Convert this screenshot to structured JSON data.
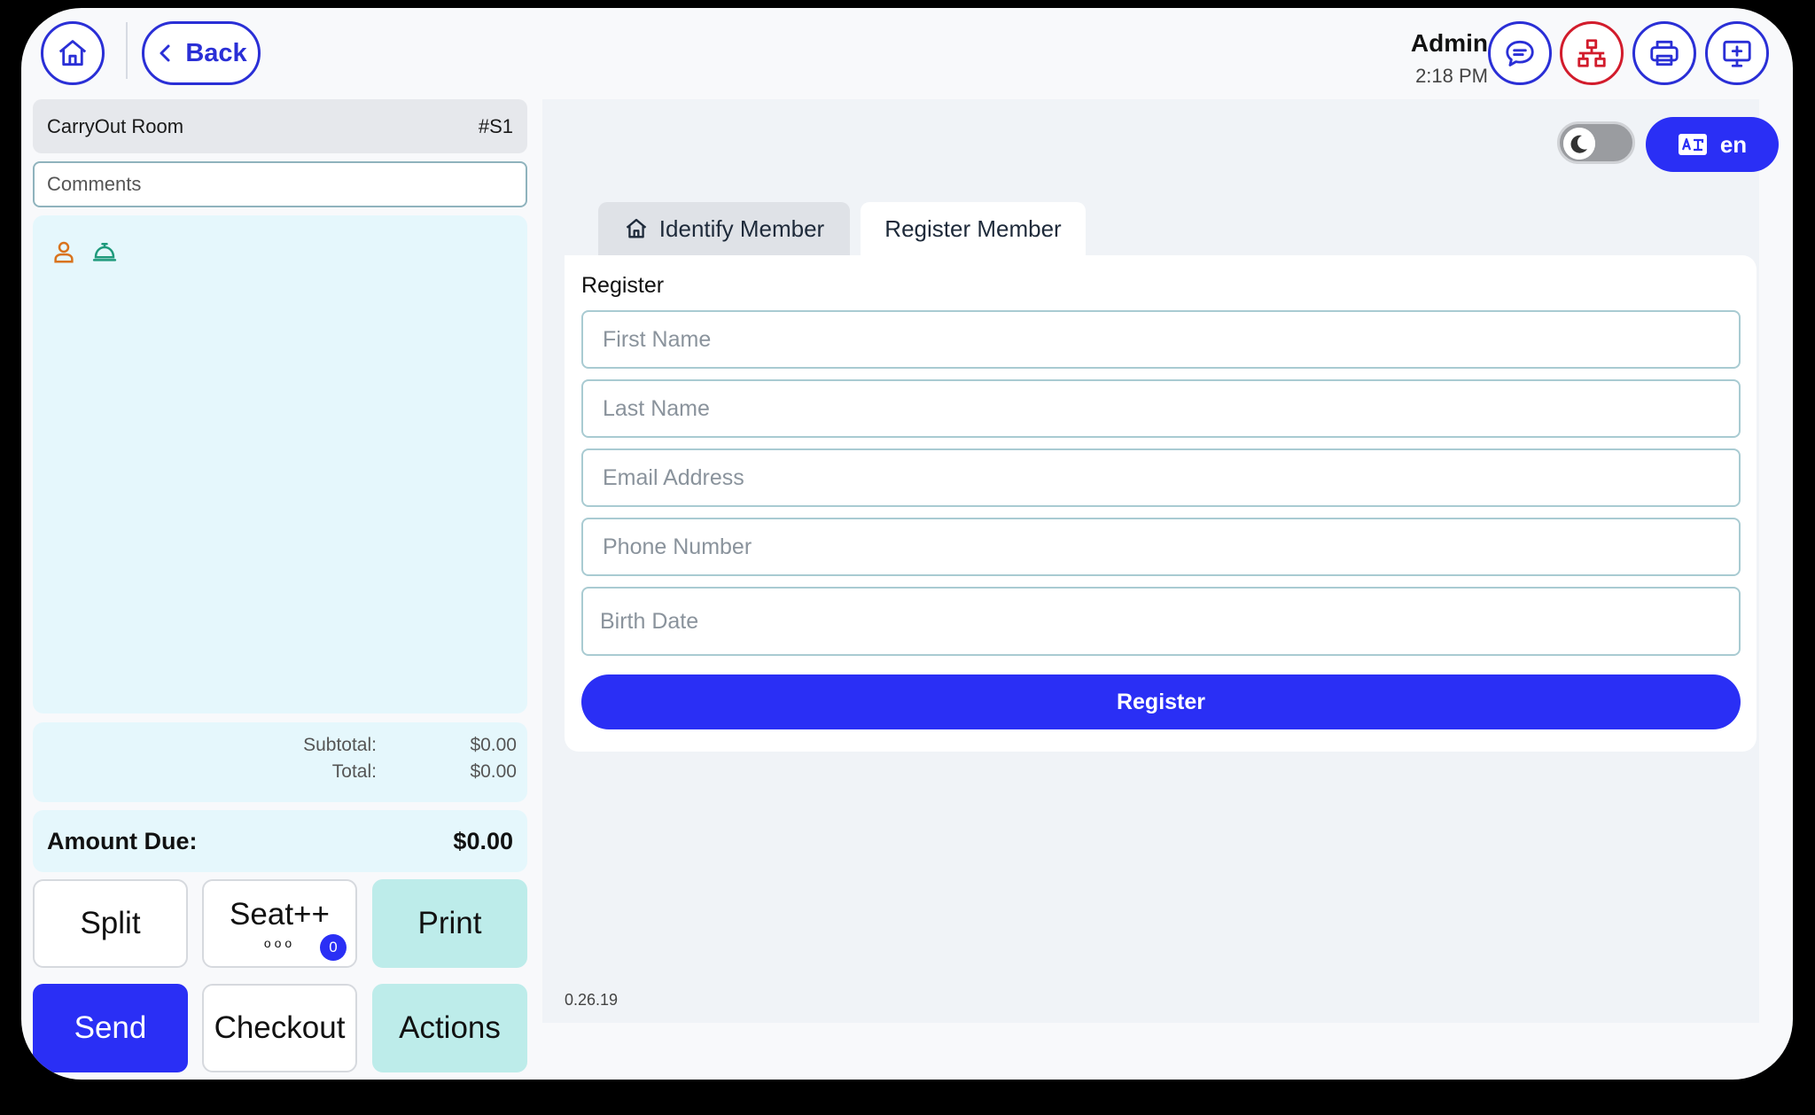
{
  "header": {
    "back_label": "Back",
    "user_name": "Admin",
    "time": "2:18 PM",
    "icons": [
      "home-icon",
      "chat-icon",
      "network-icon",
      "printer-icon",
      "add-screen-icon"
    ],
    "accent_color": "#2a2ff5",
    "alert_color": "#d21c2c"
  },
  "order": {
    "room_name": "CarryOut Room",
    "seat_code": "#S1",
    "comments_placeholder": "Comments",
    "subtotal_label": "Subtotal:",
    "subtotal_value": "$0.00",
    "total_label": "Total:",
    "total_value": "$0.00",
    "amount_due_label": "Amount Due:",
    "amount_due_value": "$0.00"
  },
  "actions": {
    "split": "Split",
    "seat": "Seat++",
    "seat_dots": "ooo",
    "seat_badge": "0",
    "print": "Print",
    "send": "Send",
    "checkout": "Checkout",
    "actions": "Actions"
  },
  "main": {
    "language": "en",
    "tabs": [
      {
        "label": "Identify Member",
        "active": false
      },
      {
        "label": "Register Member",
        "active": true
      }
    ],
    "form": {
      "title": "Register",
      "first_name_placeholder": "First Name",
      "last_name_placeholder": "Last Name",
      "email_placeholder": "Email Address",
      "phone_placeholder": "Phone Number",
      "birth_date_placeholder": "Birth Date",
      "submit_label": "Register"
    },
    "version": "0.26.19"
  }
}
